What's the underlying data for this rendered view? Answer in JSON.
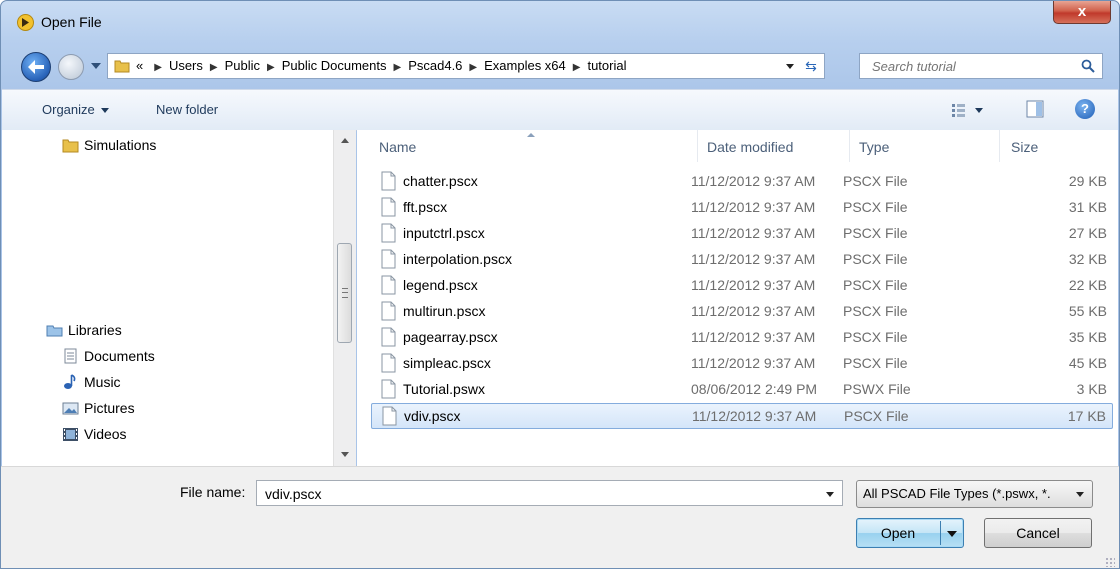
{
  "window": {
    "title": "Open File",
    "close_label": "x"
  },
  "nav": {
    "breadcrumb": [
      "«",
      "Users",
      "Public",
      "Public Documents",
      "Pscad4.6",
      "Examples x64",
      "tutorial"
    ],
    "search_placeholder": "Search tutorial"
  },
  "toolbar": {
    "organize_label": "Organize",
    "new_folder_label": "New folder"
  },
  "sidebar": {
    "items": [
      {
        "label": "Simulations",
        "icon": "folder-icon"
      },
      {
        "label": "Libraries",
        "icon": "libraries-icon"
      },
      {
        "label": "Documents",
        "icon": "document-icon"
      },
      {
        "label": "Music",
        "icon": "music-icon"
      },
      {
        "label": "Pictures",
        "icon": "pictures-icon"
      },
      {
        "label": "Videos",
        "icon": "videos-icon"
      }
    ]
  },
  "files": {
    "columns": {
      "name": "Name",
      "date": "Date modified",
      "type": "Type",
      "size": "Size"
    },
    "rows": [
      {
        "name": "chatter.pscx",
        "date": "11/12/2012 9:37 AM",
        "type": "PSCX File",
        "size": "29 KB"
      },
      {
        "name": "fft.pscx",
        "date": "11/12/2012 9:37 AM",
        "type": "PSCX File",
        "size": "31 KB"
      },
      {
        "name": "inputctrl.pscx",
        "date": "11/12/2012 9:37 AM",
        "type": "PSCX File",
        "size": "27 KB"
      },
      {
        "name": "interpolation.pscx",
        "date": "11/12/2012 9:37 AM",
        "type": "PSCX File",
        "size": "32 KB"
      },
      {
        "name": "legend.pscx",
        "date": "11/12/2012 9:37 AM",
        "type": "PSCX File",
        "size": "22 KB"
      },
      {
        "name": "multirun.pscx",
        "date": "11/12/2012 9:37 AM",
        "type": "PSCX File",
        "size": "55 KB"
      },
      {
        "name": "pagearray.pscx",
        "date": "11/12/2012 9:37 AM",
        "type": "PSCX File",
        "size": "35 KB"
      },
      {
        "name": "simpleac.pscx",
        "date": "11/12/2012 9:37 AM",
        "type": "PSCX File",
        "size": "45 KB"
      },
      {
        "name": "Tutorial.pswx",
        "date": "08/06/2012 2:49 PM",
        "type": "PSWX File",
        "size": "3 KB"
      },
      {
        "name": "vdiv.pscx",
        "date": "11/12/2012 9:37 AM",
        "type": "PSCX File",
        "size": "17 KB"
      }
    ],
    "selected_index": 9
  },
  "footer": {
    "filename_label": "File name:",
    "filename_value": "vdiv.pscx",
    "filter_label": "All PSCAD File Types (*.pswx, *.",
    "open_label": "Open",
    "cancel_label": "Cancel"
  }
}
